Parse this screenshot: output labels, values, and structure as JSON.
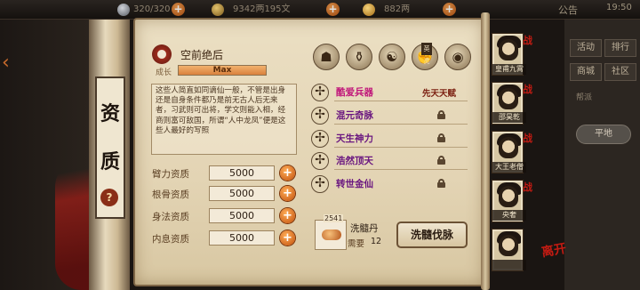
{
  "topbar": {
    "energy": "320/320",
    "money": "9342两195文",
    "ingot": "882两",
    "notice": "公告",
    "time": "19:50"
  },
  "side_menu": {
    "buttons": [
      "活动",
      "排行",
      "商城",
      "社区"
    ],
    "pill": "平地",
    "small_label": "帮派"
  },
  "tag": {
    "chars": [
      "资",
      "质"
    ],
    "help_icon": "?"
  },
  "header": {
    "title": "空前绝后",
    "growth_label": "成长",
    "growth_value": "Max",
    "growth_fraction": 1.0
  },
  "description": "这些人简直如同谪仙一般，不管是出身还是自身条件都乃是前无古人后无来者，习武则可出将，学文则能入相，经商则富可敌国，所谓“人中龙凤”便是这些人最好的写照",
  "attributes": [
    {
      "label": "臂力资质",
      "value": "5000"
    },
    {
      "label": "根骨资质",
      "value": "5000"
    },
    {
      "label": "身法资质",
      "value": "5000"
    },
    {
      "label": "内息资质",
      "value": "5000"
    }
  ],
  "skill_icons": [
    {
      "icon": "hat-icon",
      "glyph": "☗"
    },
    {
      "icon": "pot-icon",
      "glyph": "⚱"
    },
    {
      "icon": "yinyang-icon",
      "glyph": "☯"
    },
    {
      "icon": "fist-icon",
      "glyph": "✊"
    },
    {
      "icon": "jade-icon",
      "glyph": "◉"
    }
  ],
  "skill_badge": "英灵",
  "talents": [
    {
      "name": "酷爱兵器",
      "right": "先天天赋",
      "locked": false,
      "active": true
    },
    {
      "name": "混元奇脉",
      "right": "",
      "locked": true,
      "active": false
    },
    {
      "name": "天生神力",
      "right": "",
      "locked": true,
      "active": false
    },
    {
      "name": "浩然顶天",
      "right": "",
      "locked": true,
      "active": false
    },
    {
      "name": "转世金仙",
      "right": "",
      "locked": true,
      "active": false
    }
  ],
  "item": {
    "count": "2541",
    "name": "洗髓丹",
    "need_label": "需要",
    "need_value": "12",
    "button": "洗髓伐脉"
  },
  "characters": [
    {
      "name": "皇甫九霄"
    },
    {
      "name": "邵昊乾"
    },
    {
      "name": "大王老僧"
    },
    {
      "name": "央奢"
    },
    {
      "name": ""
    }
  ],
  "char_flag": "战",
  "corner_mark": "离开",
  "colors": {
    "accent_orange": "#d9813d",
    "talent_purple": "#6a1780",
    "talent_active": "#c0167a",
    "parchment": "#e3d4b4"
  }
}
